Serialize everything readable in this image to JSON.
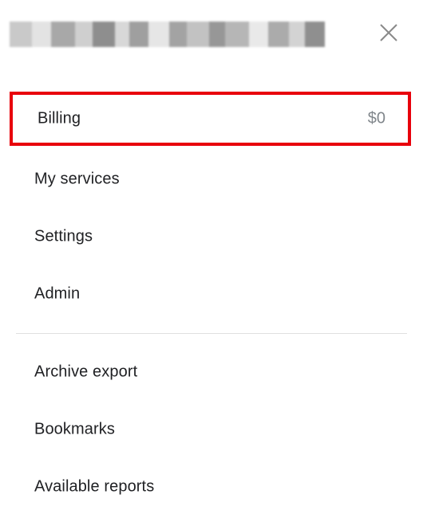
{
  "header": {
    "account_name_redacted": true,
    "close_icon": "close-icon"
  },
  "menu": {
    "billing": {
      "label": "Billing",
      "value": "$0",
      "highlight_color": "#e8000b"
    },
    "my_services": {
      "label": "My services"
    },
    "settings": {
      "label": "Settings"
    },
    "admin": {
      "label": "Admin"
    },
    "archive_export": {
      "label": "Archive export"
    },
    "bookmarks": {
      "label": "Bookmarks"
    },
    "available_reports": {
      "label": "Available reports"
    }
  }
}
